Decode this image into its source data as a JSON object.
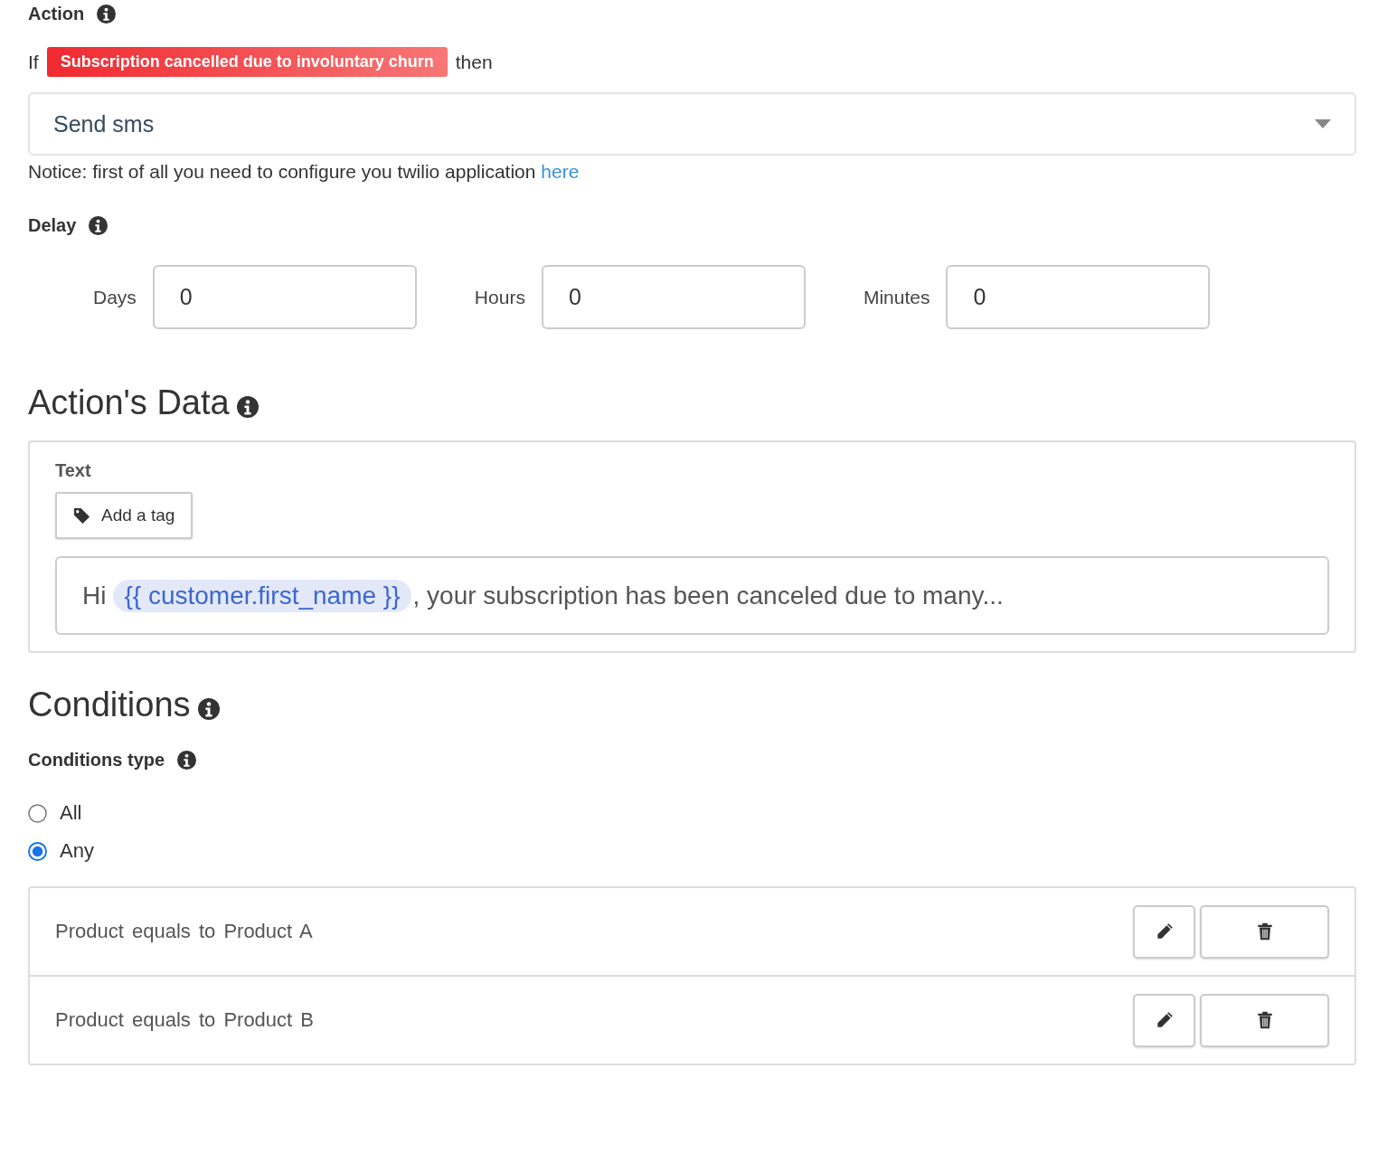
{
  "action": {
    "label": "Action",
    "if_word": "If",
    "trigger_badge": "Subscription cancelled due to involuntary churn",
    "then_word": "then",
    "select_value": "Send sms",
    "notice": "Notice: first of all you need to configure you twilio application",
    "notice_link": "here"
  },
  "delay": {
    "label": "Delay",
    "fields": [
      {
        "label": "Days",
        "value": "0"
      },
      {
        "label": "Hours",
        "value": "0"
      },
      {
        "label": "Minutes",
        "value": "0"
      }
    ]
  },
  "actions_data": {
    "heading": "Action's Data",
    "text_label": "Text",
    "add_tag_button": "Add a tag",
    "message": [
      {
        "kind": "text",
        "text": "Hi"
      },
      {
        "kind": "tag",
        "text": "{{ customer.first_name }}"
      },
      {
        "kind": "text",
        "text": ", your subscription has been canceled due to many..."
      }
    ]
  },
  "conditions": {
    "heading": "Conditions",
    "type_label": "Conditions type",
    "options": [
      {
        "label": "All",
        "selected": false
      },
      {
        "label": "Any",
        "selected": true
      }
    ],
    "rows": [
      {
        "field": "Product",
        "operator": "equals to",
        "value": "Product A"
      },
      {
        "field": "Product",
        "operator": "equals to",
        "value": "Product B"
      }
    ]
  }
}
